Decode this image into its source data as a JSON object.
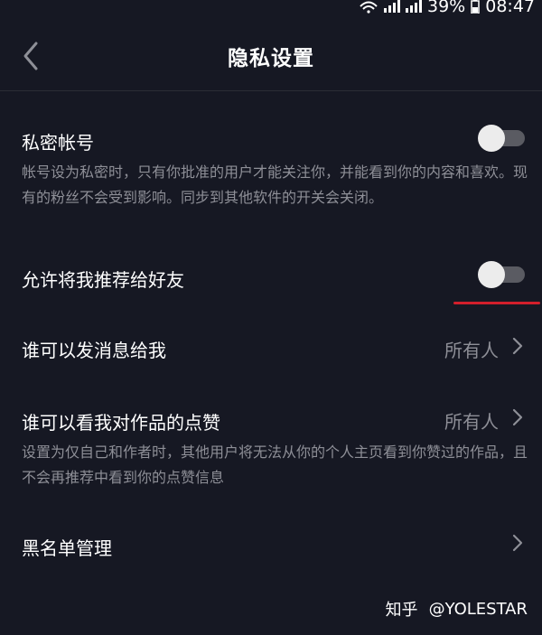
{
  "status_bar": {
    "battery": "39%",
    "time": "08:47",
    "icons": [
      "wifi-icon",
      "signal-2g-icon",
      "signal-4g-icon",
      "battery-icon"
    ]
  },
  "header": {
    "back_icon": "chevron-left-icon",
    "title": "隐私设置"
  },
  "settings": {
    "private_account": {
      "label": "私密帐号",
      "enabled": false,
      "description": "帐号设为私密时，只有你批准的用户才能关注你，并能看到你的内容和喜欢。现有的粉丝不会受到影响。同步到其他软件的开关会关闭。"
    },
    "recommend_to_friends": {
      "label": "允许将我推荐给好友",
      "enabled": false
    },
    "who_can_message": {
      "label": "谁可以发消息给我",
      "value": "所有人"
    },
    "who_can_view_likes": {
      "label": "谁可以看我对作品的点赞",
      "value": "所有人",
      "description": "设置为仅自己和作者时，其他用户将无法从你的个人主页看到你赞过的作品，且不会再推荐中看到你的点赞信息"
    },
    "blacklist": {
      "label": "黑名单管理"
    }
  },
  "watermark": {
    "site": "知乎",
    "user": "@YOLESTAR"
  },
  "colors": {
    "background": "#161823",
    "text_secondary": "#8e8f97",
    "toggle_track": "#5a5b62",
    "toggle_knob": "#ececec",
    "highlight_line": "#d21f2b"
  }
}
